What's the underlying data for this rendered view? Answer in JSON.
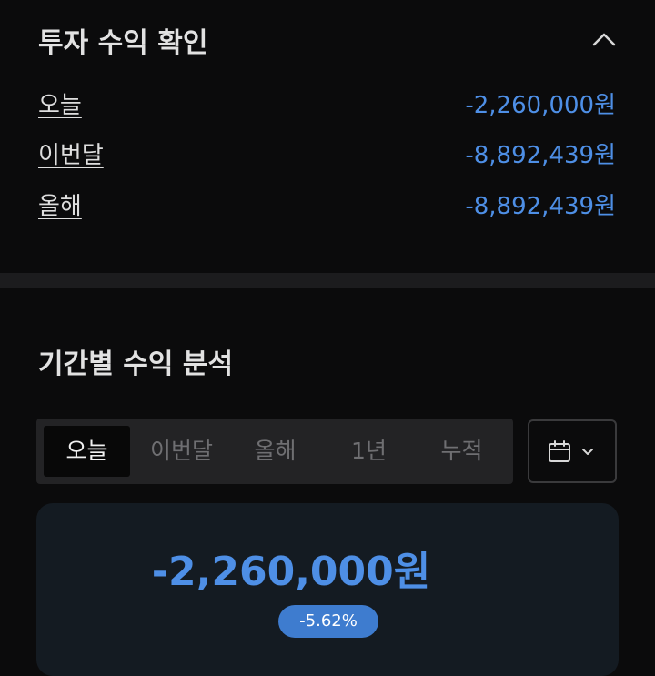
{
  "profit_check": {
    "title": "투자 수익 확인",
    "rows": [
      {
        "label": "오늘",
        "value": "-2,260,000원"
      },
      {
        "label": "이번달",
        "value": "-8,892,439원"
      },
      {
        "label": "올해",
        "value": "-8,892,439원"
      }
    ]
  },
  "period_analysis": {
    "title": "기간별 수익 분석",
    "tabs": [
      "오늘",
      "이번달",
      "올해",
      "1년",
      "누적"
    ],
    "selected_tab": "오늘",
    "amount": "-2,260,000원",
    "percent": "-5.62%"
  },
  "icons": {
    "collapse": "chevron-up-icon",
    "calendar": "calendar-icon",
    "dropdown": "chevron-down-icon"
  },
  "colors": {
    "accent_blue": "#4e8fe6",
    "badge_blue": "#3e7ccf",
    "background": "#0b0b0c"
  }
}
